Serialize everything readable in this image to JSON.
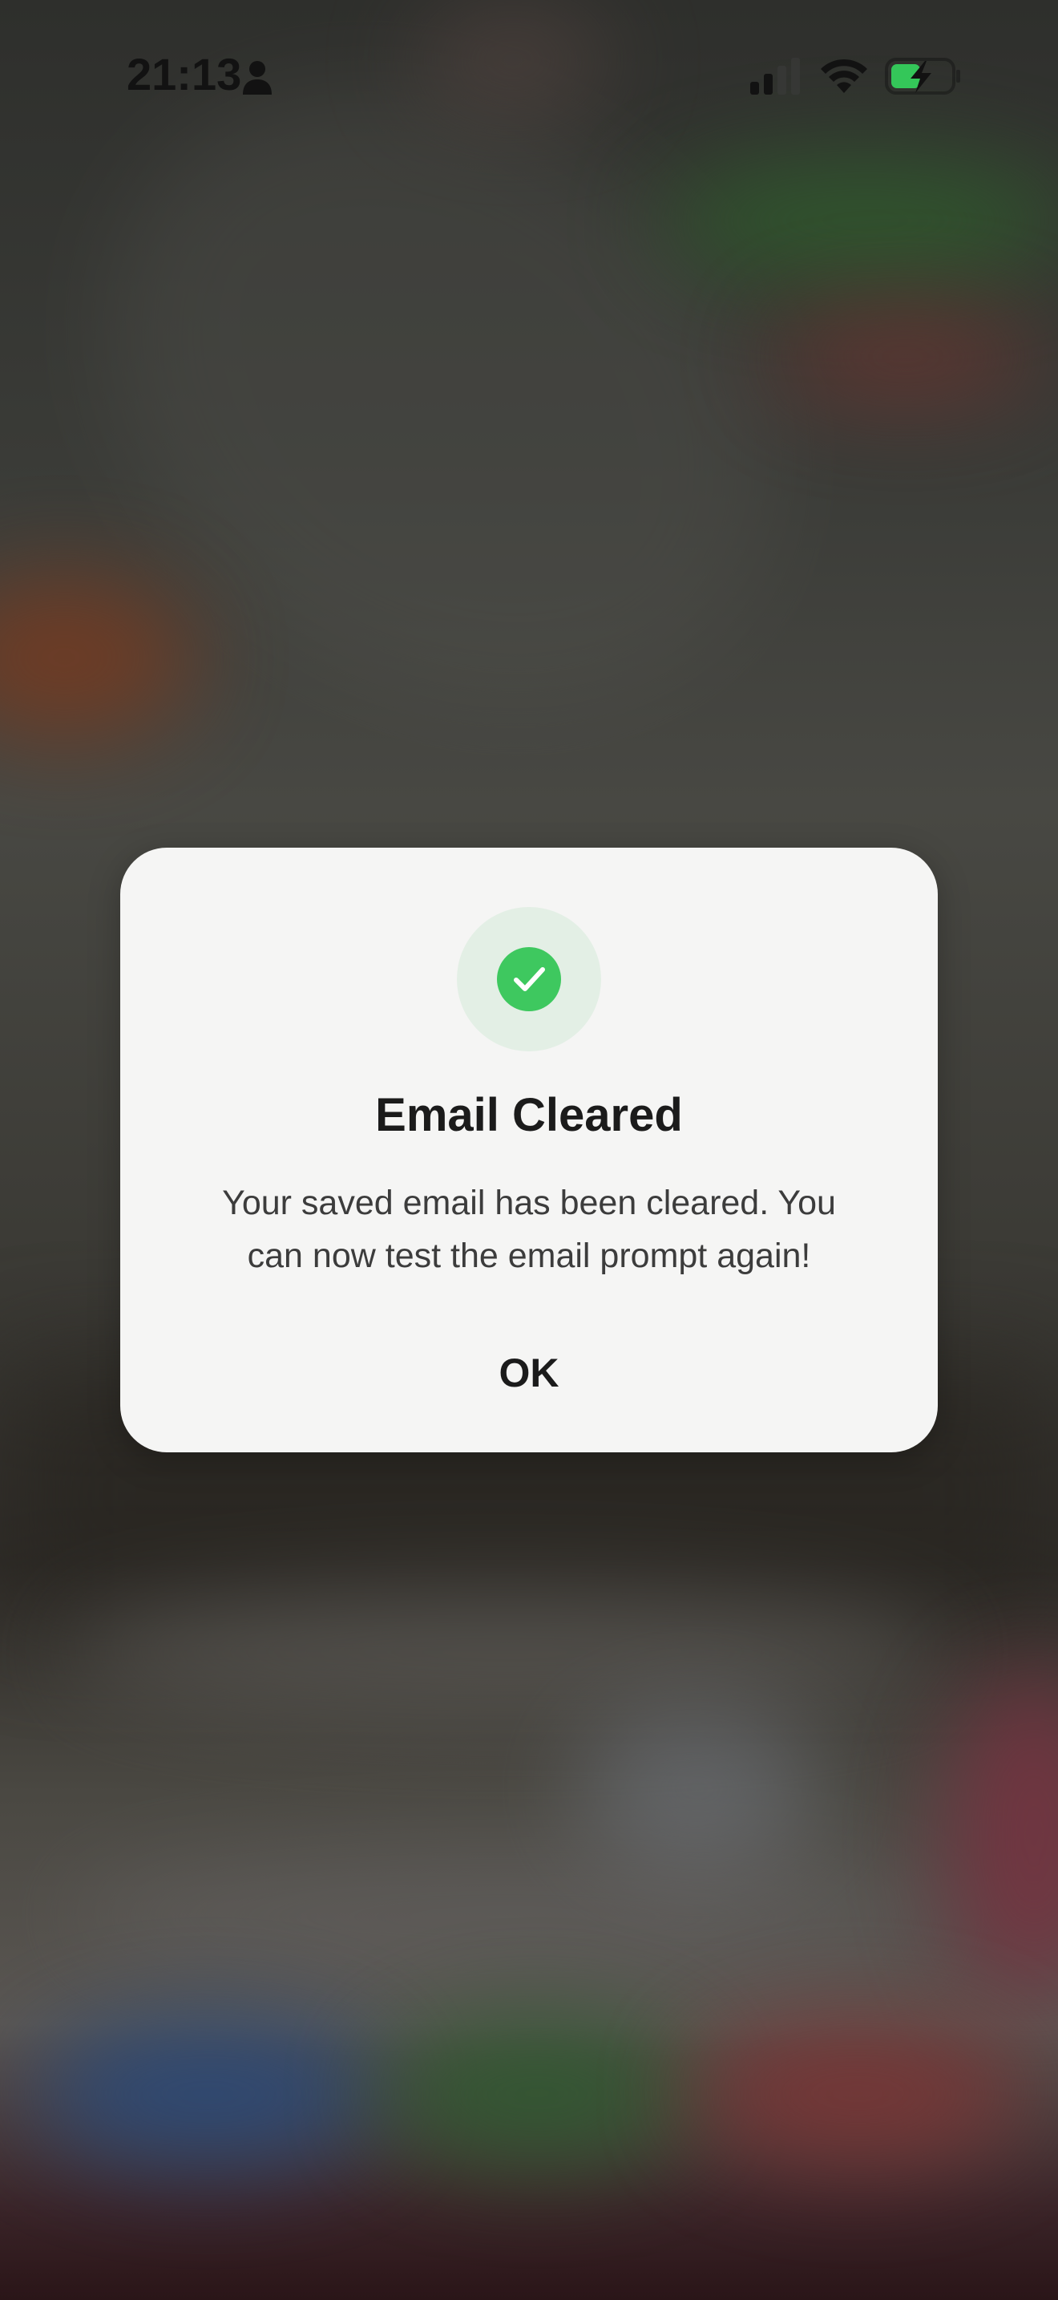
{
  "status_bar": {
    "time": "21:13",
    "icons": [
      "person-icon",
      "signal-icon",
      "wifi-icon",
      "battery-charging-icon"
    ],
    "battery_color": "#34c759"
  },
  "dialog": {
    "icon": "checkmark-icon",
    "accent_color": "#3ec85f",
    "title": "Email Cleared",
    "message": "Your saved email has been cleared. You can now test the email prompt again!",
    "ok_label": "OK"
  }
}
